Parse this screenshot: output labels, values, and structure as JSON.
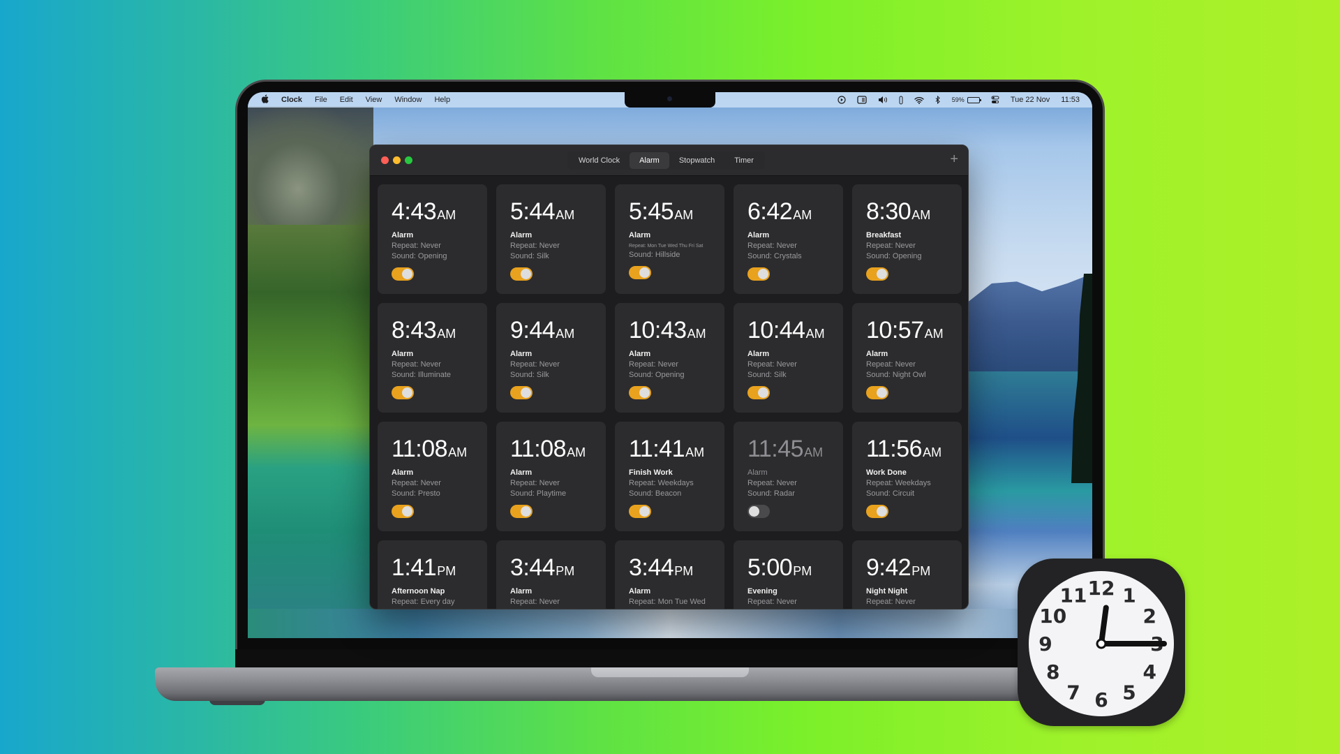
{
  "menubar": {
    "apple_icon": "apple-logo-icon",
    "app_name": "Clock",
    "menus": [
      "File",
      "Edit",
      "View",
      "Window",
      "Help"
    ],
    "status_icons": [
      "screen-record-icon",
      "display-icon",
      "volume-icon",
      "pen-icon",
      "wifi-icon",
      "bluetooth-icon"
    ],
    "battery_percent": "59%",
    "battery_level": 0.59,
    "control_center_icon": "control-center-icon",
    "date": "Tue 22 Nov",
    "time": "11:53"
  },
  "window": {
    "tabs": [
      {
        "label": "World Clock",
        "active": false
      },
      {
        "label": "Alarm",
        "active": true
      },
      {
        "label": "Stopwatch",
        "active": false
      },
      {
        "label": "Timer",
        "active": false
      }
    ],
    "add_label": "+",
    "alarms": [
      {
        "time": "4:43",
        "ampm": "AM",
        "label": "Alarm",
        "repeat": "Repeat: Never",
        "sound": "Sound: Opening",
        "enabled": true
      },
      {
        "time": "5:44",
        "ampm": "AM",
        "label": "Alarm",
        "repeat": "Repeat: Never",
        "sound": "Sound: Silk",
        "enabled": true
      },
      {
        "time": "5:45",
        "ampm": "AM",
        "label": "Alarm",
        "repeat": "Repeat: Mon Tue Wed Thu Fri Sat",
        "sound": "Sound: Hillside",
        "enabled": true
      },
      {
        "time": "6:42",
        "ampm": "AM",
        "label": "Alarm",
        "repeat": "Repeat: Never",
        "sound": "Sound: Crystals",
        "enabled": true
      },
      {
        "time": "8:30",
        "ampm": "AM",
        "label": "Breakfast",
        "repeat": "Repeat: Never",
        "sound": "Sound: Opening",
        "enabled": true
      },
      {
        "time": "8:43",
        "ampm": "AM",
        "label": "Alarm",
        "repeat": "Repeat: Never",
        "sound": "Sound: Illuminate",
        "enabled": true
      },
      {
        "time": "9:44",
        "ampm": "AM",
        "label": "Alarm",
        "repeat": "Repeat: Never",
        "sound": "Sound: Silk",
        "enabled": true
      },
      {
        "time": "10:43",
        "ampm": "AM",
        "label": "Alarm",
        "repeat": "Repeat: Never",
        "sound": "Sound: Opening",
        "enabled": true
      },
      {
        "time": "10:44",
        "ampm": "AM",
        "label": "Alarm",
        "repeat": "Repeat: Never",
        "sound": "Sound: Silk",
        "enabled": true
      },
      {
        "time": "10:57",
        "ampm": "AM",
        "label": "Alarm",
        "repeat": "Repeat: Never",
        "sound": "Sound: Night Owl",
        "enabled": true
      },
      {
        "time": "11:08",
        "ampm": "AM",
        "label": "Alarm",
        "repeat": "Repeat: Never",
        "sound": "Sound: Presto",
        "enabled": true
      },
      {
        "time": "11:08",
        "ampm": "AM",
        "label": "Alarm",
        "repeat": "Repeat: Never",
        "sound": "Sound: Playtime",
        "enabled": true
      },
      {
        "time": "11:41",
        "ampm": "AM",
        "label": "Finish Work",
        "repeat": "Repeat: Weekdays",
        "sound": "Sound: Beacon",
        "enabled": true
      },
      {
        "time": "11:45",
        "ampm": "AM",
        "label": "Alarm",
        "repeat": "Repeat: Never",
        "sound": "Sound: Radar",
        "enabled": false
      },
      {
        "time": "11:56",
        "ampm": "AM",
        "label": "Work Done",
        "repeat": "Repeat: Weekdays",
        "sound": "Sound: Circuit",
        "enabled": true
      },
      {
        "time": "1:41",
        "ampm": "PM",
        "label": "Afternoon Nap",
        "repeat": "Repeat: Every day",
        "sound": "",
        "enabled": true
      },
      {
        "time": "3:44",
        "ampm": "PM",
        "label": "Alarm",
        "repeat": "Repeat: Never",
        "sound": "",
        "enabled": true
      },
      {
        "time": "3:44",
        "ampm": "PM",
        "label": "Alarm",
        "repeat": "Repeat: Mon Tue Wed",
        "sound": "",
        "enabled": true
      },
      {
        "time": "5:00",
        "ampm": "PM",
        "label": "Evening",
        "repeat": "Repeat: Never",
        "sound": "",
        "enabled": true
      },
      {
        "time": "9:42",
        "ampm": "PM",
        "label": "Night Night",
        "repeat": "Repeat: Never",
        "sound": "",
        "enabled": true
      }
    ]
  },
  "app_icon": {
    "name": "clock-app-icon",
    "numerals": [
      "12",
      "1",
      "2",
      "3",
      "4",
      "5",
      "6",
      "7",
      "8",
      "9",
      "10",
      "11"
    ],
    "shown_time": "12:15"
  },
  "colors": {
    "toggle_on": "#e9a21d",
    "card_bg": "#2c2c2e",
    "window_bg": "#1d1d1f"
  }
}
